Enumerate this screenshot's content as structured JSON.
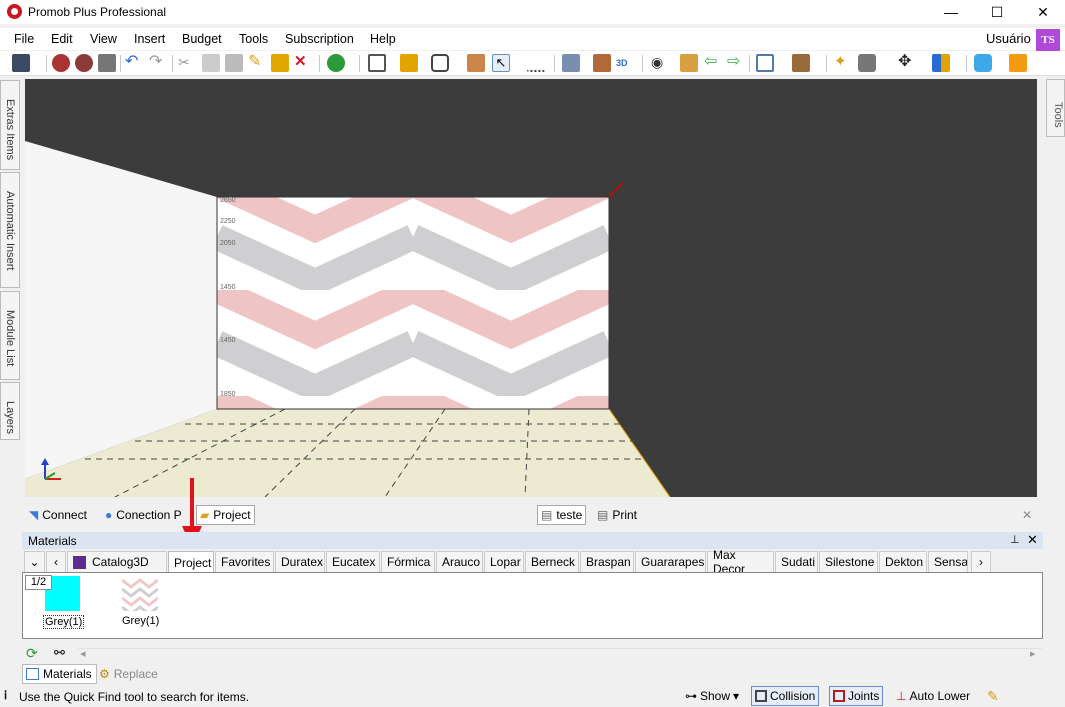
{
  "app": {
    "title": "Promob Plus Professional",
    "user": "Usuário",
    "avatar_initials": "TS"
  },
  "window_controls": {
    "minimize": "—",
    "maximize": "☐",
    "close": "✕"
  },
  "menu": [
    "File",
    "Edit",
    "View",
    "Insert",
    "Budget",
    "Tools",
    "Subscription",
    "Help"
  ],
  "left_panels": [
    "Extras Items",
    "Automatic Insert",
    "Module List",
    "Layers"
  ],
  "right_panels": [
    "Tools"
  ],
  "scene": {
    "ruler_marks": [
      "2650",
      "2250",
      "2050",
      "1450",
      "1450",
      "1850"
    ]
  },
  "bottom_bar": {
    "connect": "Connect",
    "connection": "Conection P",
    "project": "Project",
    "teste": "teste",
    "print": "Print",
    "close": "✕"
  },
  "materials": {
    "title": "Materials",
    "pin": "📌",
    "close": "✕",
    "tabs": [
      "Catalog3D",
      "Project",
      "Favorites",
      "Duratex",
      "Eucatex",
      "Fórmica",
      "Arauco",
      "Lopar",
      "Berneck",
      "Braspan",
      "Guararapes",
      "Max Decor",
      "Sudati",
      "Silestone",
      "Dekton",
      "Sensa"
    ],
    "active_tab": "Project",
    "page": "1/2",
    "items": [
      {
        "label": "Grey(1)",
        "color": "#00ffff"
      },
      {
        "label": "Grey(1)",
        "color": "#e8c8c8"
      }
    ],
    "bottom_tabs": [
      "Materials",
      "Replace"
    ]
  },
  "status": {
    "message": "Use the Quick Find tool to search for items.",
    "show": "Show",
    "collision": "Collision",
    "joints": "Joints",
    "auto_lower": "Auto Lower"
  },
  "colors": {
    "accent": "#c8171e",
    "viewport_bg": "#3c3c3c",
    "floor": "#ecebd2",
    "arrow": "#e4101b"
  }
}
